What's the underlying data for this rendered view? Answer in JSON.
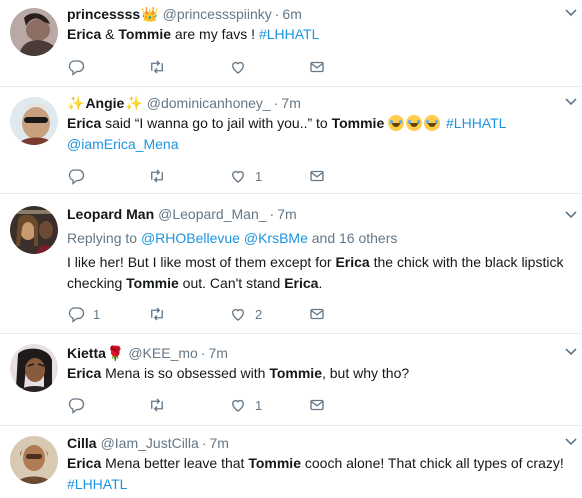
{
  "tweets": [
    {
      "name": "princessss",
      "name_emoji": "👑",
      "handle": "@princessspiinky",
      "dot": "·",
      "time": "6m",
      "text": [
        {
          "t": "Erica",
          "b": true
        },
        {
          "t": " & "
        },
        {
          "t": "Tommie",
          "b": true
        },
        {
          "t": " are my favs !  "
        },
        {
          "t": "#LHHATL",
          "link": true
        }
      ],
      "reply_count": "",
      "retweet_count": "",
      "like_count": ""
    },
    {
      "name_prefix_emoji": "✨",
      "name": "Angie",
      "name_emoji": "✨",
      "handle": "@dominicanhoney_",
      "dot": "·",
      "time": "7m",
      "text": [
        {
          "t": "Erica",
          "b": true
        },
        {
          "t": " said “I wanna go to jail with you..” to "
        },
        {
          "t": "Tommie",
          "b": true
        },
        {
          "t": " "
        },
        {
          "t": "😂😂😂",
          "laugh": 3
        },
        {
          "t": " "
        },
        {
          "t": "#LHHATL",
          "link": true
        },
        {
          "br": true
        },
        {
          "t": "@iamErica_Mena",
          "link": true
        }
      ],
      "reply_count": "",
      "retweet_count": "",
      "like_count": "1"
    },
    {
      "name": "Leopard Man",
      "handle": "@Leopard_Man_",
      "dot": "·",
      "time": "7m",
      "replying": {
        "prefix": "Replying to ",
        "users": [
          "@RHOBellevue",
          "@KrsBMe"
        ],
        "suffix": " and 16 others"
      },
      "text": [
        {
          "t": "I like her! But I like most of them except for "
        },
        {
          "t": "Erica",
          "b": true
        },
        {
          "t": " the chick with the black lipstick"
        },
        {
          "br": true
        },
        {
          "t": "checking "
        },
        {
          "t": "Tommie",
          "b": true
        },
        {
          "t": " out. Can't stand "
        },
        {
          "t": "Erica",
          "b": true
        },
        {
          "t": "."
        }
      ],
      "reply_count": "1",
      "retweet_count": "",
      "like_count": "2"
    },
    {
      "name": "Kietta",
      "name_emoji": "🌹",
      "handle": "@KEE_mo",
      "dot": "·",
      "time": "7m",
      "text": [
        {
          "t": "Erica",
          "b": true
        },
        {
          "t": " Mena is so obsessed with "
        },
        {
          "t": "Tommie",
          "b": true
        },
        {
          "t": ", but why tho?"
        }
      ],
      "reply_count": "",
      "retweet_count": "",
      "like_count": "1"
    },
    {
      "name": "Cilla",
      "handle": "@Iam_JustCilla",
      "dot": "·",
      "time": "7m",
      "text": [
        {
          "t": "Erica",
          "b": true
        },
        {
          "t": " Mena better leave that "
        },
        {
          "t": "Tommie",
          "b": true
        },
        {
          "t": " cooch alone! That chick all types of crazy!"
        },
        {
          "br": true
        },
        {
          "t": "#LHHATL",
          "link": true
        }
      ],
      "reply_count": "",
      "retweet_count": "",
      "like_count": ""
    }
  ],
  "icons": {
    "reply": "reply-icon",
    "retweet": "retweet-icon",
    "like": "heart-icon",
    "dm": "envelope-icon",
    "caret": "chevron-down-icon"
  },
  "colors": {
    "text": "#14171a",
    "muted": "#657786",
    "link": "#1b95e0",
    "border": "#e6ecf0"
  }
}
